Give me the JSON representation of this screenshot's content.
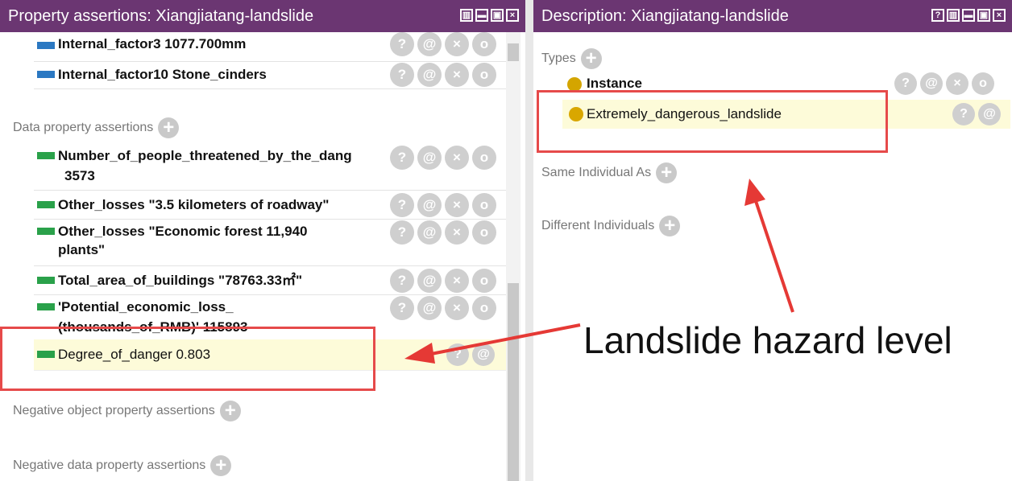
{
  "left": {
    "title": "Property assertions: Xiangjiatang-landslide",
    "window_controls": [
      "restore-icon",
      "minimize-icon",
      "maximize-icon",
      "close-icon"
    ],
    "object_rows": [
      {
        "text": "Internal_factor3  1077.700mm"
      },
      {
        "text": "Internal_factor10  Stone_cinders"
      }
    ],
    "data_section_label": "Data property assertions",
    "data_rows": [
      {
        "line1": "Number_of_people_threatened_by_the_dang",
        "line2": "3573"
      },
      {
        "line1": "Other_losses  \"3.5 kilometers of roadway\"",
        "line2": ""
      },
      {
        "line1": "Other_losses  \"Economic forest 11,940",
        "line2": "plants\""
      },
      {
        "line1": "Total_area_of_buildings  \"78763.33㎡\"",
        "line2": ""
      },
      {
        "line1": "'Potential_economic_loss_",
        "line2": "(thousands_of_RMB)'  115893"
      },
      {
        "line1": "Degree_of_danger  0.803",
        "line2": ""
      }
    ],
    "negative_object_label": "Negative object property assertions",
    "negative_data_label": "Negative data property assertions"
  },
  "right": {
    "title": "Description: Xiangjiatang-landslide",
    "window_controls": [
      "help-icon",
      "restore-icon",
      "minimize-icon",
      "maximize-icon",
      "close-icon"
    ],
    "types_label": "Types",
    "types_items": [
      {
        "label": "Instance"
      },
      {
        "label": "Extremely_dangerous_landslide"
      }
    ],
    "same_individual_label": "Same Individual As",
    "different_individuals_label": "Different Individuals"
  },
  "annotation": {
    "text": "Landslide hazard level",
    "arrow_color": "#e53935"
  },
  "colors": {
    "titlebar": "#6b3672",
    "object_property": "#2b78c2",
    "data_property": "#2aa14a",
    "class_bullet": "#d9a700",
    "highlight": "#fdfbd9"
  },
  "icons": {
    "help": "?",
    "annotate": "@",
    "delete": "×",
    "edit": "o",
    "add": "+"
  }
}
